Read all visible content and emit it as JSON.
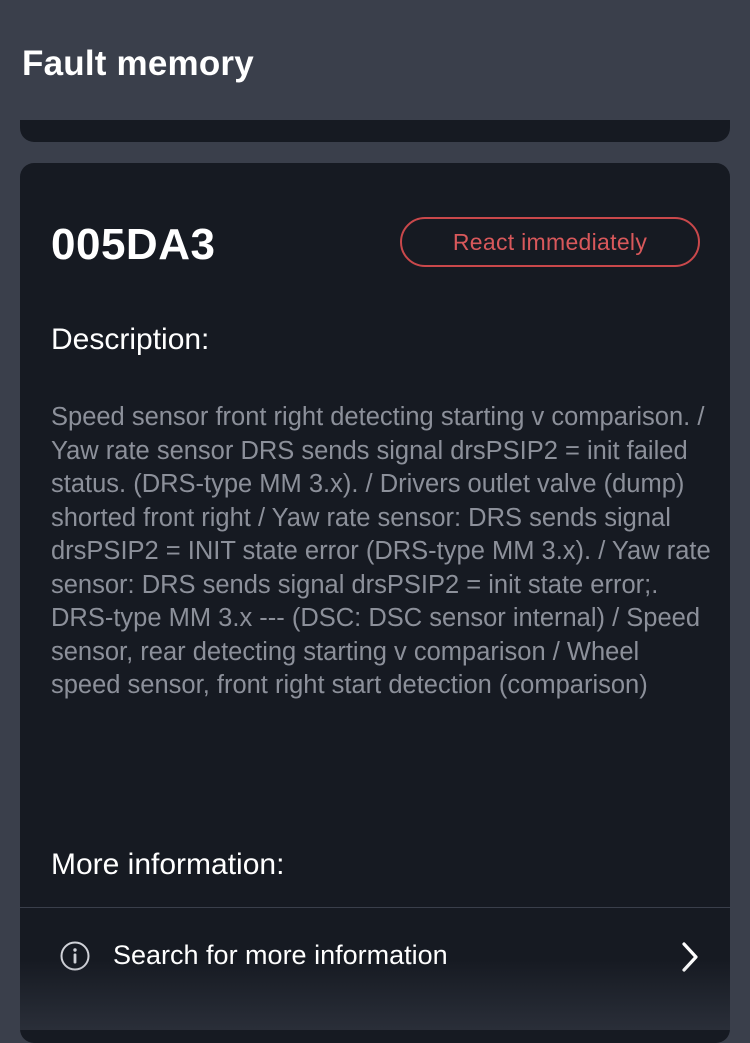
{
  "header": {
    "title": "Fault memory"
  },
  "fault": {
    "code": "005DA3",
    "severity_label": "React immediately",
    "description_heading": "Description:",
    "description_text": "Speed sensor front right detecting starting v comparison. / Yaw rate sensor DRS sends signal drsPSIP2 = init failed status. (DRS-type MM 3.x). / Drivers outlet valve (dump) shorted front right / Yaw rate sensor: DRS sends signal drsPSIP2 = INIT state error (DRS-type MM 3.x). / Yaw rate sensor: DRS sends signal drsPSIP2 = init state error;. DRS-type MM 3.x --- (DSC: DSC sensor internal) / Speed sensor, rear detecting starting v comparison / Wheel speed sensor, front right start detection (comparison)",
    "more_info_heading": "More information:",
    "search_label": "Search for more information"
  },
  "icons": {
    "info": "info-circle-icon",
    "chevron": "chevron-right-icon"
  },
  "colors": {
    "background": "#3a3f4b",
    "card": "#161a22",
    "severity": "#d8585b",
    "muted_text": "#8c909a"
  }
}
